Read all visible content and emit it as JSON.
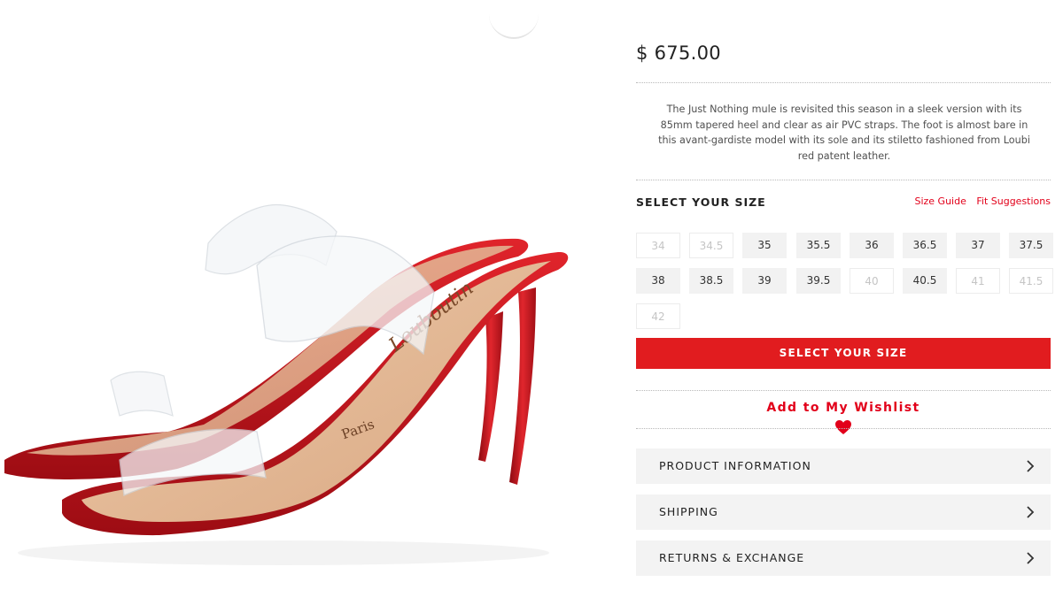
{
  "product": {
    "price": "$ 675.00",
    "description": "The Just Nothing mule is revisited this season in a sleek version with its 85mm tapered heel and clear as air PVC straps. The foot is almost bare in this avant-gardiste model with its sole and its stiletto fashioned from Loubi red patent leather.",
    "insole_brand": "Louboutin",
    "insole_city": "Paris"
  },
  "size_section": {
    "heading": "SELECT YOUR SIZE",
    "size_guide_label": "Size Guide",
    "fit_suggestions_label": "Fit Suggestions",
    "sizes": [
      {
        "label": "34",
        "available": false
      },
      {
        "label": "34.5",
        "available": false
      },
      {
        "label": "35",
        "available": true
      },
      {
        "label": "35.5",
        "available": true
      },
      {
        "label": "36",
        "available": true
      },
      {
        "label": "36.5",
        "available": true
      },
      {
        "label": "37",
        "available": true
      },
      {
        "label": "37.5",
        "available": true
      },
      {
        "label": "38",
        "available": true
      },
      {
        "label": "38.5",
        "available": true
      },
      {
        "label": "39",
        "available": true
      },
      {
        "label": "39.5",
        "available": true
      },
      {
        "label": "40",
        "available": false
      },
      {
        "label": "40.5",
        "available": true
      },
      {
        "label": "41",
        "available": false
      },
      {
        "label": "41.5",
        "available": false
      },
      {
        "label": "42",
        "available": false
      }
    ],
    "cta_label": "SELECT YOUR SIZE"
  },
  "wishlist": {
    "label": "Add to My Wishlist",
    "icon": "heart-icon"
  },
  "accordions": [
    {
      "label": "PRODUCT INFORMATION",
      "icon": "chevron-right-icon"
    },
    {
      "label": "SHIPPING",
      "icon": "chevron-right-icon"
    },
    {
      "label": "RETURNS & EXCHANGE",
      "icon": "chevron-right-icon"
    }
  ],
  "colors": {
    "accent_red": "#e11c1f",
    "link_red": "#e2001a",
    "sole_red": "#c2121b",
    "insole_nude": "#e2b694",
    "button_grey": "#f2f2f2"
  }
}
